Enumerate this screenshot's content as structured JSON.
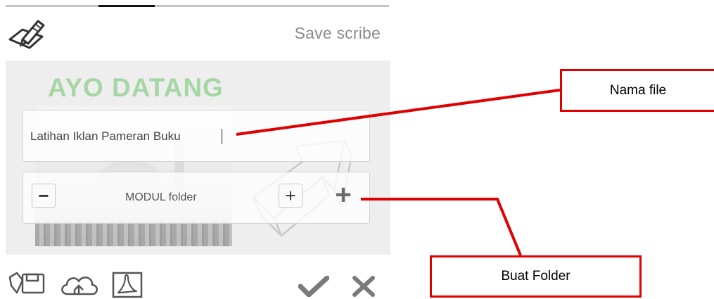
{
  "header": {
    "title": "Save scribe",
    "logo_icon": "pen-on-paper-icon"
  },
  "canvas": {
    "headline": "AYO DATANG",
    "headline_color": "#a7d6a5"
  },
  "file_name": {
    "value": "Latihan Iklan Pameran Buku",
    "placeholder": ""
  },
  "folder": {
    "minus_label": "−",
    "name": "MODUL folder",
    "plus_label": "+",
    "new_folder_label": "+"
  },
  "footer": {
    "actions": [
      {
        "name": "save-local-icon"
      },
      {
        "name": "cloud-icon"
      },
      {
        "name": "pdf-icon"
      },
      {
        "name": "checkmark-icon"
      },
      {
        "name": "close-icon"
      }
    ]
  },
  "annotations": {
    "file_name_label": "Nama file",
    "new_folder_label": "Buat Folder",
    "color": "#e00000"
  }
}
